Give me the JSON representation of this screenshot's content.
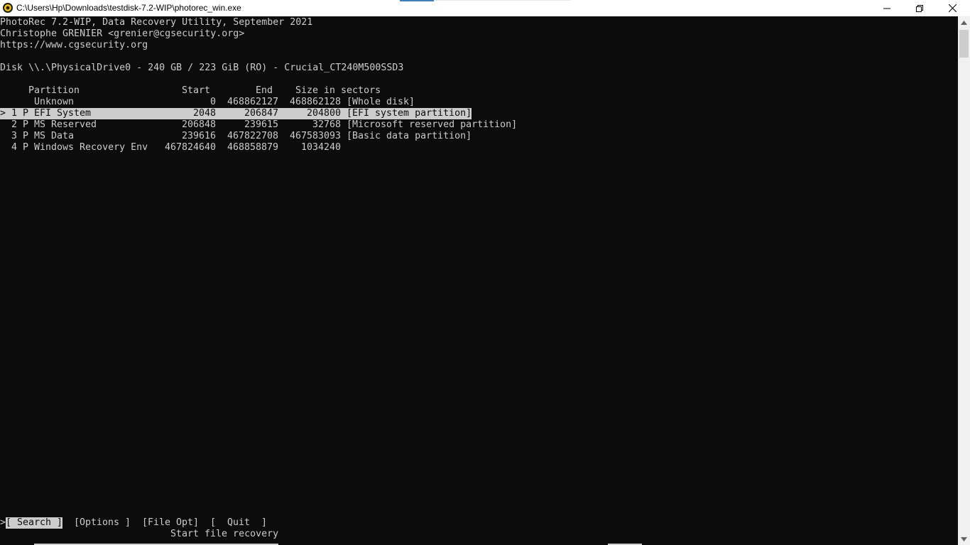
{
  "window": {
    "title": "C:\\Users\\Hp\\Downloads\\testdisk-7.2-WIP\\photorec_win.exe"
  },
  "header": {
    "line1": "PhotoRec 7.2-WIP, Data Recovery Utility, September 2021",
    "line2": "Christophe GRENIER <grenier@cgsecurity.org>",
    "line3": "https://www.cgsecurity.org"
  },
  "disk": {
    "line": "Disk \\\\.\\PhysicalDrive0 - 240 GB / 223 GiB (RO) - Crucial_CT240M500SSD3"
  },
  "table": {
    "headers": {
      "partition": "Partition",
      "start": "Start",
      "end": "End",
      "size": "Size in sectors"
    },
    "rows": [
      {
        "marker": " ",
        "num": " ",
        "type": " ",
        "name": "Unknown",
        "start": "0",
        "end": "468862127",
        "size": "468862128",
        "desc": "[Whole disk]"
      },
      {
        "marker": ">",
        "num": "1",
        "type": "P",
        "name": "EFI System",
        "start": "2048",
        "end": "206847",
        "size": "204800",
        "desc": "[EFI system partition]"
      },
      {
        "marker": " ",
        "num": "2",
        "type": "P",
        "name": "MS Reserved",
        "start": "206848",
        "end": "239615",
        "size": "32768",
        "desc": "[Microsoft reserved partition]"
      },
      {
        "marker": " ",
        "num": "3",
        "type": "P",
        "name": "MS Data",
        "start": "239616",
        "end": "467822708",
        "size": "467583093",
        "desc": "[Basic data partition]"
      },
      {
        "marker": " ",
        "num": "4",
        "type": "P",
        "name": "Windows Recovery Env",
        "start": "467824640",
        "end": "468858879",
        "size": "1034240",
        "desc": ""
      }
    ]
  },
  "menu": {
    "cursor": ">",
    "search": "[ Search ]",
    "options": "[Options ]",
    "file_opt": "[File Opt]",
    "quit": "[  Quit  ]",
    "hint": "Start file recovery"
  },
  "colors": {
    "console_bg": "#0c0c0c",
    "console_fg": "#cccccc",
    "selection_bg": "#cccccc"
  },
  "icons": {
    "app": "photorec-app-icon",
    "minimize": "minimize-icon",
    "maximize": "restore-icon",
    "close": "close-icon"
  }
}
